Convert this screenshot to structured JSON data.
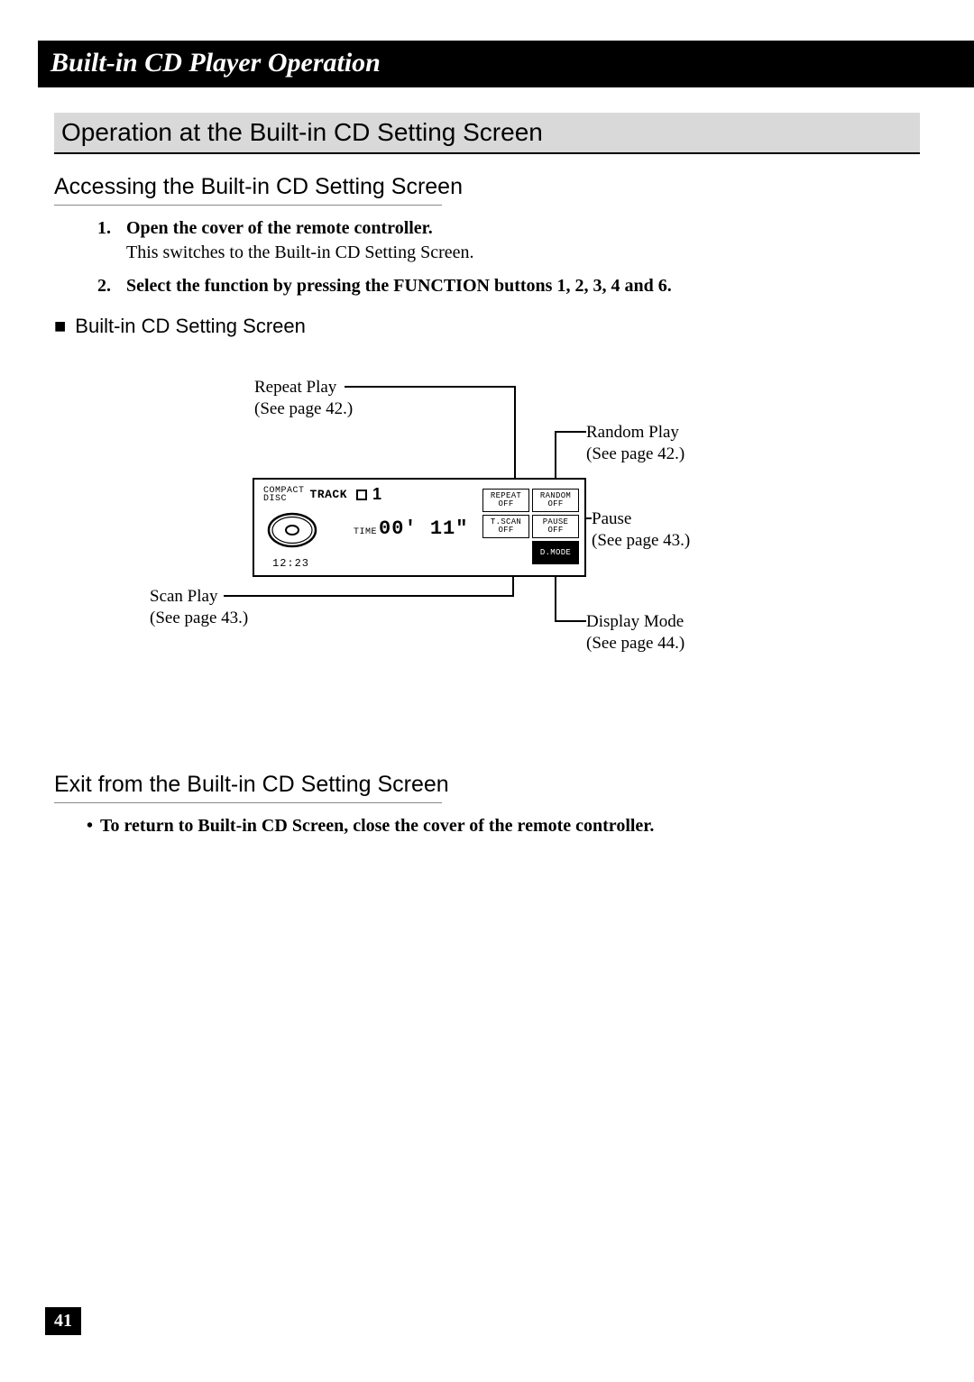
{
  "chapter_title": "Built-in CD Player Operation",
  "section_title": "Operation at the Built-in CD Setting Screen",
  "subsection1_title": "Accessing the Built-in CD Setting Screen",
  "steps": [
    {
      "num": "1.",
      "title": "Open the cover of the remote controller.",
      "desc": "This switches to the Built-in CD Setting Screen."
    },
    {
      "num": "2.",
      "title": "Select the function by pressing the FUNCTION buttons 1, 2, 3, 4 and 6.",
      "desc": ""
    }
  ],
  "square_lead": "Built-in CD Setting Screen",
  "callouts": {
    "repeat": {
      "label": "Repeat Play",
      "ref": "(See page 42.)"
    },
    "random": {
      "label": "Random Play",
      "ref": "(See page 42.)"
    },
    "pause": {
      "label": "Pause",
      "ref": "(See page 43.)"
    },
    "display": {
      "label": "Display Mode",
      "ref": "(See page 44.)"
    },
    "scan": {
      "label": "Scan Play",
      "ref": "(See page 43.)"
    }
  },
  "lcd": {
    "compact": "Compact\nDisc",
    "track_label": "TRACK",
    "track_num": "1",
    "time_label": "TIME",
    "time_val": "00' 11\"",
    "clock": "12:23",
    "fx": {
      "repeat": "REPEAT\nOFF",
      "random": "RANDOM\nOFF",
      "tscan": "T.SCAN\nOFF",
      "pause": "PAUSE\nOFF",
      "dmode": "D.MODE"
    }
  },
  "subsection2_title": "Exit from the Built-in CD Setting Screen",
  "exit_bullet": "To return to Built-in CD Screen, close the cover of the remote controller.",
  "page_number": "41"
}
